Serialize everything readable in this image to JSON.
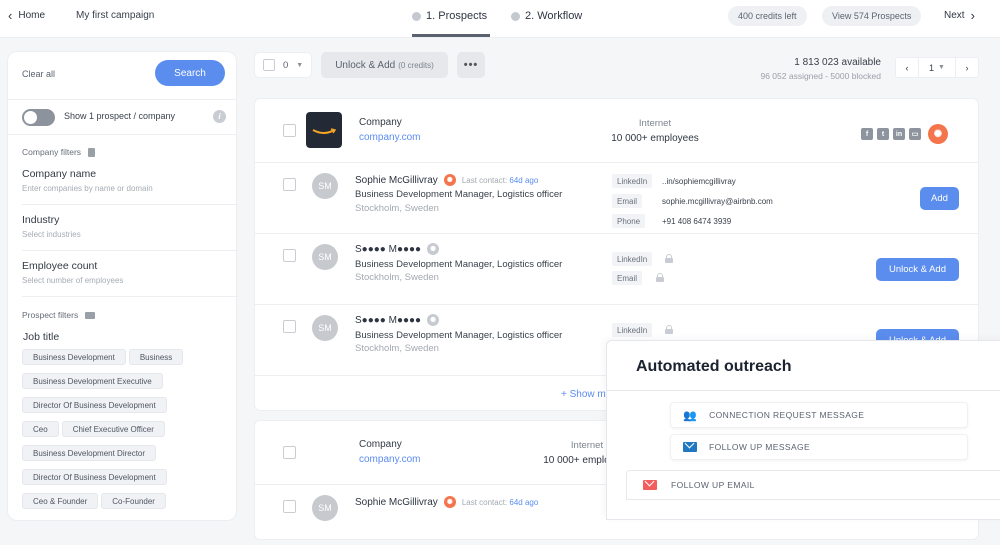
{
  "topbar": {
    "home_label": "Home",
    "campaign_name": "My first campaign",
    "tabs": [
      {
        "label": "1. Prospects",
        "active": true
      },
      {
        "label": "2. Workflow",
        "active": false
      }
    ],
    "credits_left": "400 credits left",
    "view_prospects": "View 574 Prospects",
    "next_label": "Next"
  },
  "sidebar": {
    "clear_all": "Clear all",
    "search_label": "Search",
    "toggle_label": "Show 1 prospect / company",
    "toggle_on": false,
    "company_filters_label": "Company filters",
    "company_fields": [
      {
        "title": "Company name",
        "placeholder": "Enter companies by name or domain"
      },
      {
        "title": "Industry",
        "placeholder": "Select industries"
      },
      {
        "title": "Employee count",
        "placeholder": "Select number of employees"
      }
    ],
    "prospect_filters_label": "Prospect filters",
    "job_title_label": "Job title",
    "job_titles": [
      "Business Development",
      "Business",
      "Business Development Executive",
      "Director Of Business Development",
      "Ceo",
      "Chief Executive Officer",
      "Business Development Director",
      "Director Of Business Development",
      "Ceo & Founder",
      "Co-Founder"
    ]
  },
  "toolbar": {
    "selected_count": "0",
    "unlock_add_label": "Unlock & Add",
    "unlock_add_credits": "(0 credits)",
    "more_label": "•••",
    "available": "1 813 023 available",
    "assigned_blocked": "96 052 assigned - 5000 blocked",
    "page": "1"
  },
  "results": [
    {
      "company": {
        "name": "Company",
        "domain": "company.com",
        "industry": "Internet",
        "employees": "10 000+ employees"
      },
      "socials": [
        "facebook",
        "twitter",
        "linkedin",
        "website",
        "hubspot"
      ],
      "prospects": [
        {
          "initials": "SM",
          "name": "Sophie McGillivray",
          "last_contact_label": "Last contact:",
          "last_contact_value": "64d ago",
          "title": "Business Development Manager, Logistics officer",
          "location": "Stockholm, Sweden",
          "contacts": [
            {
              "label": "LinkedIn",
              "value": "..in/sophiemcgillivray"
            },
            {
              "label": "Email",
              "value": "sophie.mcgillivray@airbnb.com"
            },
            {
              "label": "Phone",
              "value": "+91 408 6474 3939"
            }
          ],
          "action": "Add"
        },
        {
          "initials": "SM",
          "name": "S●●●● M●●●●",
          "title": "Business Development Manager, Logistics officer",
          "location": "Stockholm, Sweden",
          "contacts": [
            {
              "label": "LinkedIn",
              "locked": true
            },
            {
              "label": "Email",
              "locked": true
            }
          ],
          "action": "Unlock & Add"
        },
        {
          "initials": "SM",
          "name": "S●●●● M●●●●",
          "title": "Business Development Manager, Logistics officer",
          "location": "Stockholm, Sweden",
          "contacts": [
            {
              "label": "LinkedIn",
              "locked": true
            }
          ],
          "action": "Unlock & Add"
        }
      ],
      "show_more": "+ Show more"
    },
    {
      "company": {
        "name": "Company",
        "domain": "company.com",
        "industry": "Internet",
        "employees": "10 000+ employees"
      },
      "prospects": [
        {
          "initials": "SM",
          "name": "Sophie McGillivray",
          "last_contact_label": "Last contact:",
          "last_contact_value": "64d ago"
        }
      ]
    }
  ],
  "outreach": {
    "title": "Automated outreach",
    "steps": [
      {
        "icon": "connection-request-icon",
        "label": "CONNECTION REQUEST MESSAGE",
        "color": "#1f78c1"
      },
      {
        "icon": "message-icon",
        "label": "FOLLOW UP MESSAGE",
        "color": "#1f78c1"
      },
      {
        "icon": "email-icon",
        "label": "FOLLOW UP EMAIL",
        "color": "#f25d5d"
      }
    ]
  },
  "colors": {
    "accent": "#5b8def",
    "hubspot": "#f4744b",
    "email_red": "#f25d5d"
  }
}
